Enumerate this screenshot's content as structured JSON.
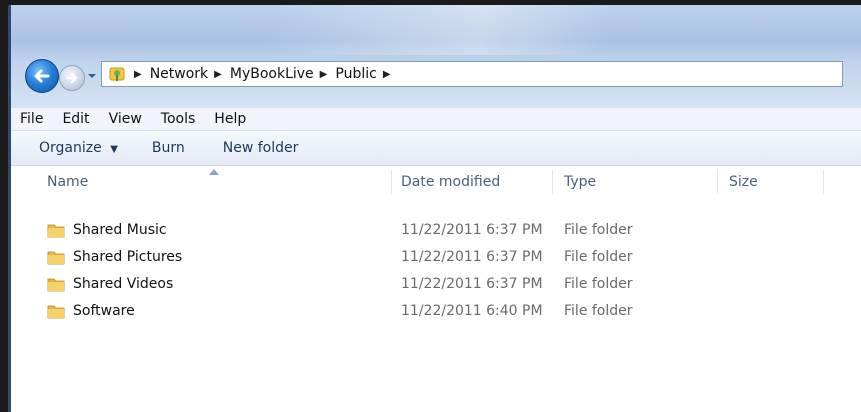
{
  "breadcrumb": [
    "Network",
    "MyBookLive",
    "Public"
  ],
  "menu": [
    "File",
    "Edit",
    "View",
    "Tools",
    "Help"
  ],
  "toolbar": {
    "organize": "Organize",
    "burn": "Burn",
    "new_folder": "New folder"
  },
  "columns": {
    "name": "Name",
    "date": "Date modified",
    "type": "Type",
    "size": "Size"
  },
  "files": [
    {
      "name": "Shared Music",
      "date": "11/22/2011 6:37 PM",
      "type": "File folder"
    },
    {
      "name": "Shared Pictures",
      "date": "11/22/2011 6:37 PM",
      "type": "File folder"
    },
    {
      "name": "Shared Videos",
      "date": "11/22/2011 6:37 PM",
      "type": "File folder"
    },
    {
      "name": "Software",
      "date": "11/22/2011 6:40 PM",
      "type": "File folder"
    }
  ],
  "icons": {
    "back": "back-arrow-icon",
    "forward": "forward-arrow-icon",
    "folder": "folder-icon",
    "network": "network-icon"
  }
}
